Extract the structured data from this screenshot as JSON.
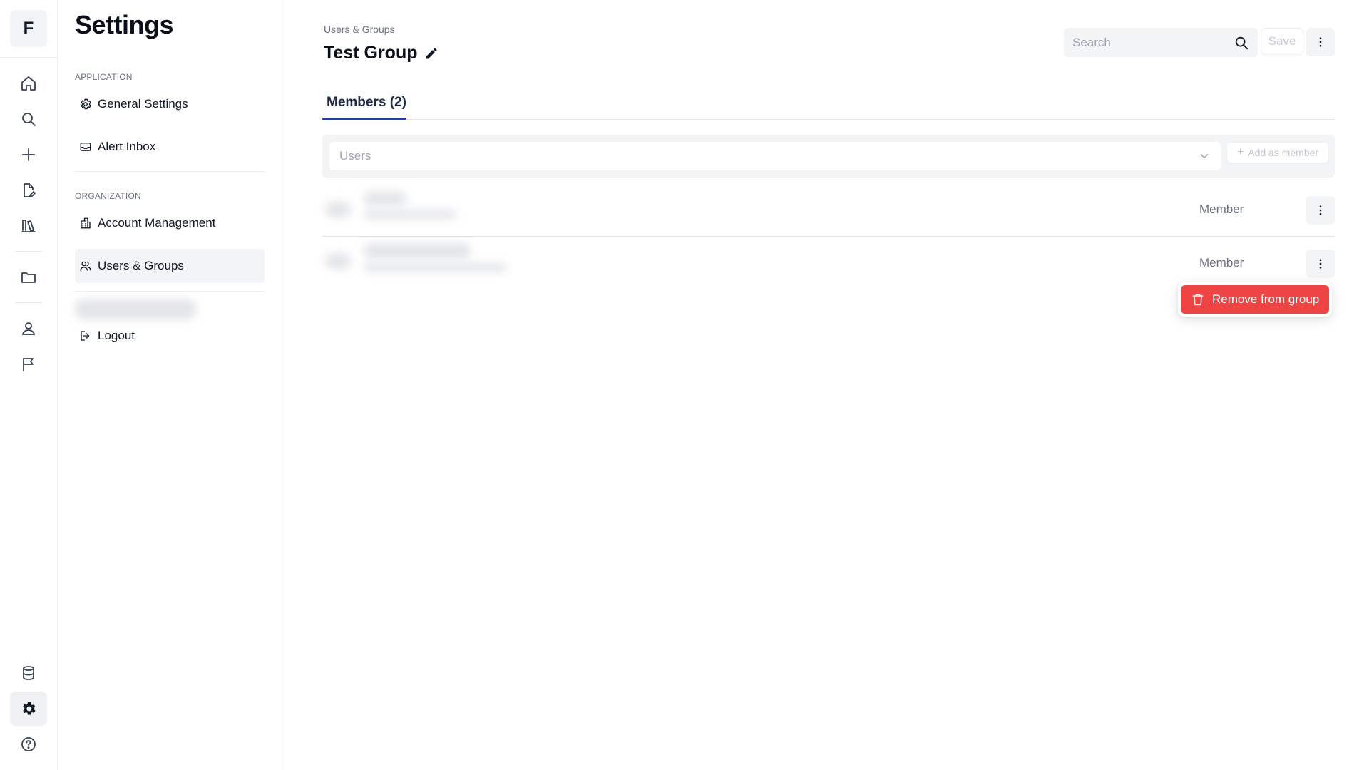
{
  "rail": {
    "logo_letter": "F",
    "icons": [
      "home-icon",
      "search-icon",
      "plus-icon",
      "file-edit-icon",
      "library-icon",
      "folder-icon",
      "user-icon",
      "flag-icon",
      "database-icon",
      "gear-icon",
      "help-icon"
    ],
    "active": "gear-icon"
  },
  "sidebar": {
    "title": "Settings",
    "sections": {
      "application": "APPLICATION",
      "organization": "ORGANIZATION"
    },
    "items": [
      {
        "label": "General Settings",
        "icon": "gear-small-icon"
      },
      {
        "label": "Alert Inbox",
        "icon": "inbox-icon"
      },
      {
        "label": "Account Management",
        "icon": "building-icon"
      },
      {
        "label": "Users & Groups",
        "icon": "users-icon",
        "active": true
      },
      {
        "label": "Logout",
        "icon": "logout-icon"
      }
    ]
  },
  "header": {
    "breadcrumb": "Users & Groups",
    "title": "Test Group",
    "search_placeholder": "Search",
    "save_label": "Save"
  },
  "tabs": [
    {
      "label": "Members (2)",
      "active": true
    }
  ],
  "add_member": {
    "users_placeholder": "Users",
    "add_label": "Add as member"
  },
  "members": [
    {
      "role": "Member"
    },
    {
      "role": "Member"
    }
  ],
  "context_menu": {
    "remove_label": "Remove from group"
  },
  "colors": {
    "accent": "#1e40af",
    "danger": "#ef4444"
  }
}
